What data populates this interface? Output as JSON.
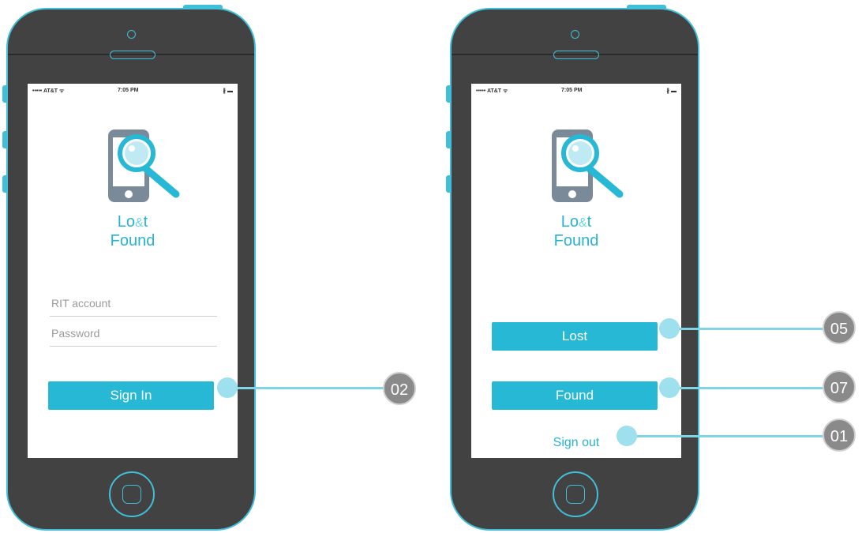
{
  "status_bar": {
    "carrier": "••••• AT&T ᯤ",
    "time": "7:05 PM",
    "battery": "∦ ▬"
  },
  "app": {
    "name_line1_a": "Lo",
    "name_amp": "&",
    "name_line1_b": "t",
    "name_line2": "Found"
  },
  "login_screen": {
    "account_placeholder": "RIT account",
    "password_placeholder": "Password",
    "sign_in_label": "Sign In",
    "callout": "02"
  },
  "home_screen": {
    "lost_label": "Lost",
    "found_label": "Found",
    "sign_out_label": "Sign out",
    "callouts": {
      "lost": "05",
      "found": "07",
      "sign_out": "01"
    }
  },
  "colors": {
    "accent": "#27b8d6",
    "phone_body": "#424242",
    "outline": "#41bfd9",
    "badge": "#8a8a8a"
  }
}
